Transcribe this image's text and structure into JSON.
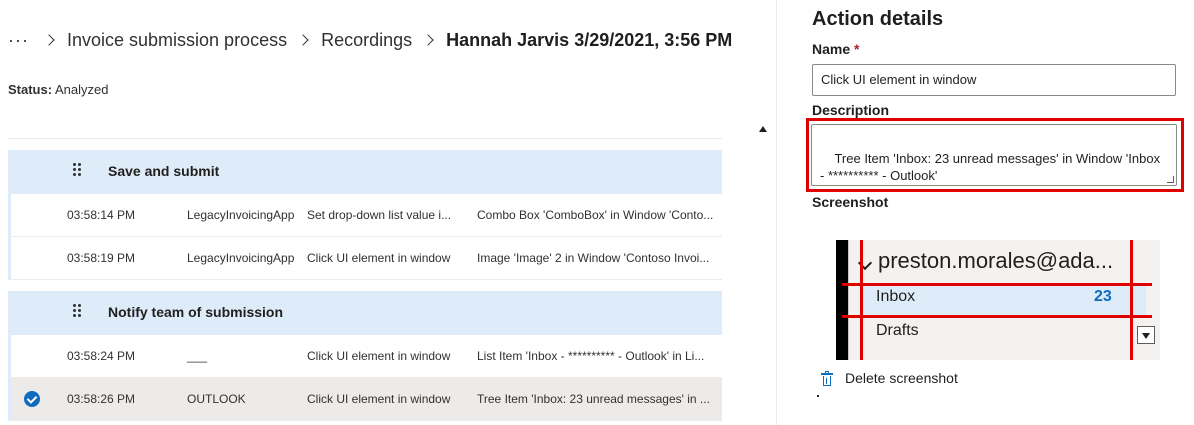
{
  "breadcrumb": {
    "overflow": "···",
    "items": [
      "Invoice submission process",
      "Recordings"
    ],
    "current": "Hannah Jarvis 3/29/2021, 3:56 PM"
  },
  "status": {
    "label": "Status:",
    "value": "Analyzed"
  },
  "groups": [
    {
      "label": "Save and submit",
      "rows": [
        {
          "time": "03:58:14 PM",
          "app": "LegacyInvoicingApp",
          "action": "Set drop-down list value i...",
          "target": "Combo Box 'ComboBox' in Window 'Conto..."
        },
        {
          "time": "03:58:19 PM",
          "app": "LegacyInvoicingApp",
          "action": "Click UI element in window",
          "target": "Image 'Image' 2 in Window 'Contoso Invoi..."
        }
      ]
    },
    {
      "label": "Notify team of submission",
      "rows": [
        {
          "time": "03:58:24 PM",
          "app": "___",
          "action": "Click UI element in window",
          "target": "List Item 'Inbox - ********** - Outlook' in Li..."
        },
        {
          "time": "03:58:26 PM",
          "app": "OUTLOOK",
          "action": "Click UI element in window",
          "target": "Tree Item 'Inbox: 23 unread messages' in ...",
          "selected": true
        }
      ]
    }
  ],
  "details": {
    "title": "Action details",
    "name_label": "Name",
    "required_mark": "*",
    "name_value": "Click UI element in window",
    "description_label": "Description",
    "description_value": "Tree Item 'Inbox: 23 unread messages' in Window 'Inbox - ********** - Outlook'",
    "screenshot_label": "Screenshot",
    "screenshot": {
      "account": "preston.morales@ada...",
      "inbox": "Inbox",
      "inbox_count": "23",
      "drafts": "Drafts"
    },
    "delete_label": "Delete screenshot"
  },
  "colors": {
    "accent": "#0f6cbd",
    "highlight": "#e00000",
    "group_bg": "#deecf9",
    "selected_bg": "#edebe9"
  }
}
